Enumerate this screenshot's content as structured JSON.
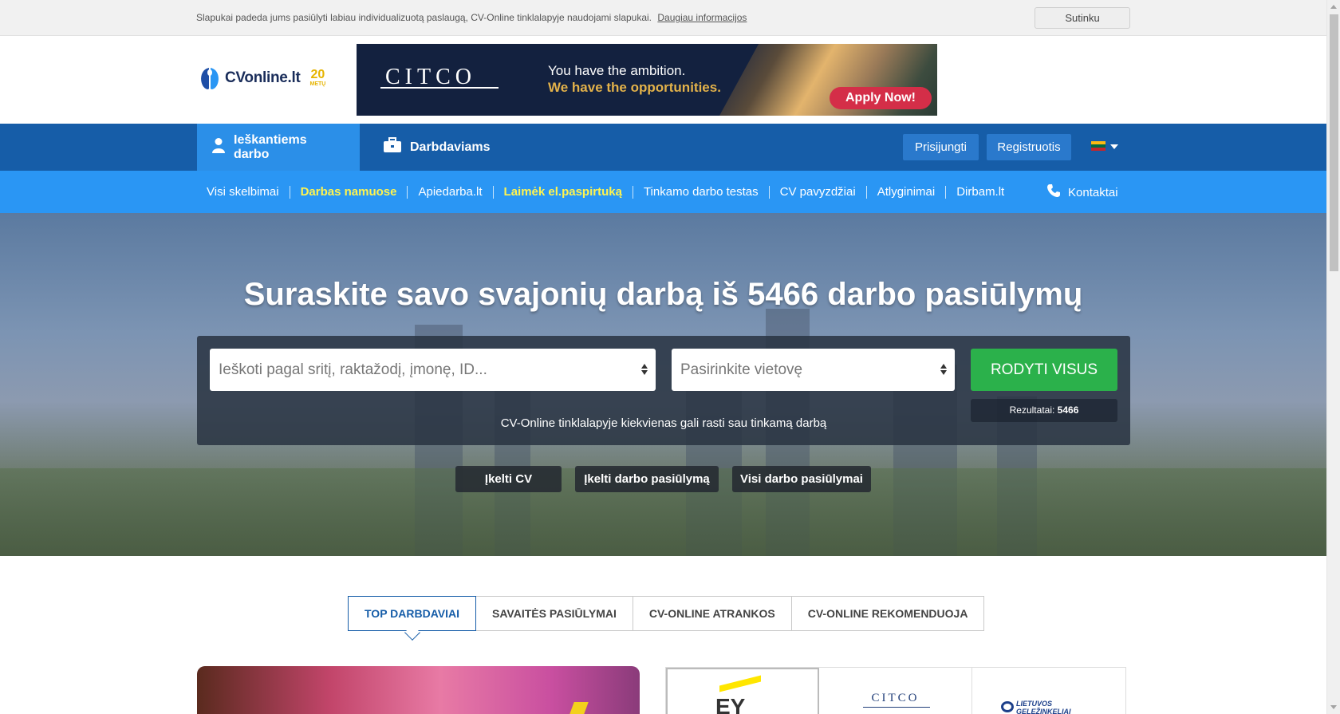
{
  "cookie": {
    "text": "Slapukai padeda jums pasiūlyti labiau individualizuotą paslaugą, CV-Online tinklalapyje naudojami slapukai.",
    "link": "Daugiau informacijos",
    "accept": "Sutinku"
  },
  "logo": {
    "name": "CVonline.lt",
    "anniversary_number": "20",
    "anniversary_text": "METŲ"
  },
  "banner": {
    "brand": "CITCO",
    "line1": "You have the ambition.",
    "line2": "We have the opportunities.",
    "cta": "Apply Now!"
  },
  "mainnav": {
    "jobseekers": "Ieškantiems darbo",
    "employers": "Darbdaviams",
    "login": "Prisijungti",
    "register": "Registruotis"
  },
  "subnav": {
    "items": [
      {
        "label": "Visi skelbimai"
      },
      {
        "label": "Darbas namuose"
      },
      {
        "label": "Apiedarba.lt"
      },
      {
        "label": "Laimėk el.paspirtuką"
      },
      {
        "label": "Tinkamo darbo testas"
      },
      {
        "label": "CV pavyzdžiai"
      },
      {
        "label": "Atlyginimai"
      },
      {
        "label": "Dirbam.lt"
      }
    ],
    "contacts": "Kontaktai"
  },
  "hero": {
    "title": "Suraskite savo svajonių darbą iš 5466 darbo pasiūlymų",
    "keyword_placeholder": "Ieškoti pagal sritį, raktažodį, įmonę, ID...",
    "location_placeholder": "Pasirinkite vietovę",
    "show_all": "RODYTI VISUS",
    "results_label": "Rezultatai:",
    "results_count": "5466",
    "tagline": "CV-Online tinklalapyje kiekvienas gali rasti sau tinkamą darbą",
    "upload_cv": "Įkelti CV",
    "upload_offer": "Įkelti darbo pasiūlymą",
    "all_offers": "Visi darbo pasiūlymai"
  },
  "tabs": [
    {
      "label": "TOP DARBDAVIAI"
    },
    {
      "label": "SAVAITĖS PASIŪLYMAI"
    },
    {
      "label": "CV-ONLINE ATRANKOS"
    },
    {
      "label": "CV-ONLINE REKOMENDUOJA"
    }
  ],
  "employers": {
    "ey": "EY",
    "citco": "CITCO",
    "lg_line1": "LIETUVOS",
    "lg_line2": "GELEŽINKELIAI"
  },
  "colors": {
    "nav_dark": "#165da8",
    "nav_light": "#2a96f4",
    "highlight": "#fff44f",
    "cta_green": "#2bb14b"
  },
  "icons": {
    "user": "user-icon",
    "briefcase": "briefcase-icon",
    "phone": "phone-icon",
    "flag": "lithuania-flag-icon"
  }
}
